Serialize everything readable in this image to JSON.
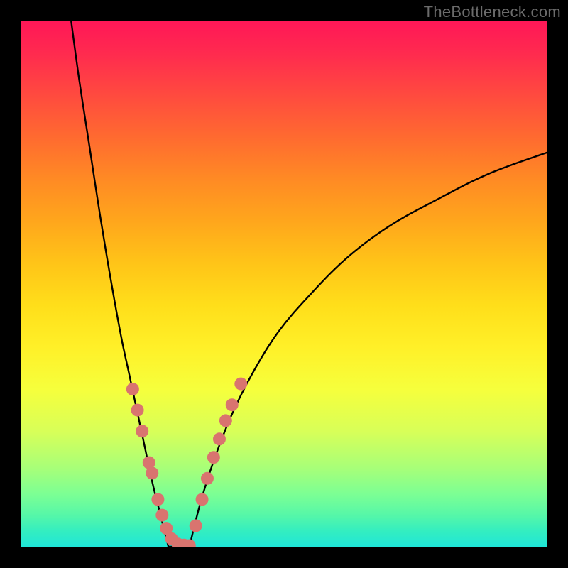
{
  "watermark": "TheBottleneck.com",
  "chart_data": {
    "type": "line",
    "title": "",
    "xlabel": "",
    "ylabel": "",
    "xlim": [
      0,
      100
    ],
    "ylim": [
      0,
      100
    ],
    "grid": false,
    "background_gradient": {
      "orientation": "vertical",
      "stops": [
        {
          "pos": 0,
          "color": "#ff1757"
        },
        {
          "pos": 14,
          "color": "#ff4a3f"
        },
        {
          "pos": 30,
          "color": "#ff8a24"
        },
        {
          "pos": 46,
          "color": "#ffc418"
        },
        {
          "pos": 62,
          "color": "#fff028"
        },
        {
          "pos": 78,
          "color": "#d8ff58"
        },
        {
          "pos": 90,
          "color": "#7cff94"
        },
        {
          "pos": 100,
          "color": "#1fe6d8"
        }
      ]
    },
    "series": [
      {
        "name": "left-branch",
        "color": "#000000",
        "x": [
          9.5,
          11,
          13,
          15,
          17,
          19,
          20.5,
          22,
          23.5,
          25,
          26.5,
          28
        ],
        "y": [
          100,
          89,
          76,
          63,
          51,
          40,
          33,
          26,
          19,
          12,
          6,
          0
        ]
      },
      {
        "name": "bottom-flat",
        "color": "#000000",
        "x": [
          28,
          30,
          32
        ],
        "y": [
          0,
          0,
          0
        ]
      },
      {
        "name": "right-branch",
        "color": "#000000",
        "x": [
          32,
          34,
          36.5,
          40,
          44,
          49,
          55,
          62,
          70,
          79,
          89,
          100
        ],
        "y": [
          0,
          8,
          16,
          25,
          33,
          41,
          48,
          55,
          61,
          66,
          71,
          75
        ]
      }
    ],
    "markers": [
      {
        "name": "left-branch-dots",
        "color": "#d9746f",
        "radius": 9,
        "x": [
          21.2,
          22.1,
          23.0,
          24.3,
          24.9,
          26.0,
          26.8,
          27.6,
          28.6,
          29.8,
          31.0,
          32.0
        ],
        "y": [
          30.0,
          26.0,
          22.0,
          16.0,
          14.0,
          9.0,
          6.0,
          3.5,
          1.5,
          0.5,
          0.3,
          0.2
        ]
      },
      {
        "name": "right-branch-dots",
        "color": "#d9746f",
        "radius": 9,
        "x": [
          33.2,
          34.4,
          35.4,
          36.6,
          37.7,
          38.9,
          40.1,
          41.8
        ],
        "y": [
          4.0,
          9.0,
          13.0,
          17.0,
          20.5,
          24.0,
          27.0,
          31.0
        ]
      }
    ]
  }
}
